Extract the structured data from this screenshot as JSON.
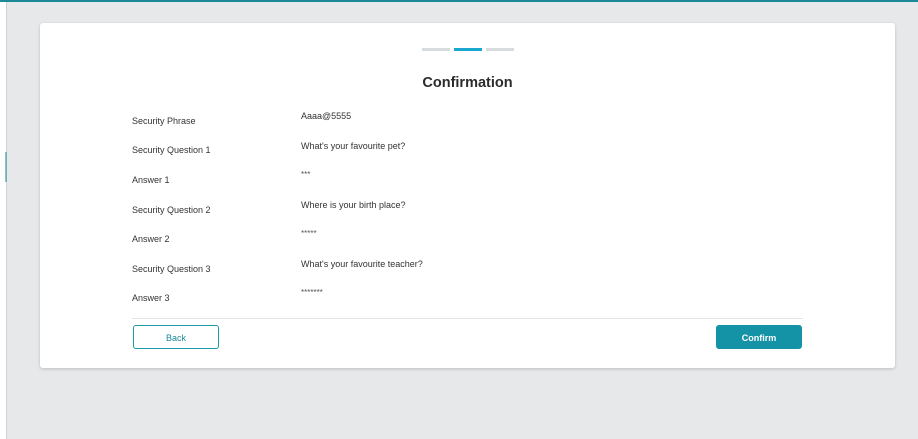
{
  "stepper": {
    "steps": [
      {
        "state": "inactive",
        "color": "#d9dcde"
      },
      {
        "state": "active",
        "color": "#1aa7cf"
      },
      {
        "state": "inactive",
        "color": "#d9dcde"
      }
    ]
  },
  "title": "Confirmation",
  "rows": [
    {
      "label": "Security Phrase",
      "value": "Aaaa@5555"
    },
    {
      "label": "Security Question 1",
      "value": "What's your favourite pet?"
    },
    {
      "label": "Answer 1",
      "value": "***"
    },
    {
      "label": "Security Question 2",
      "value": "Where is your birth place?"
    },
    {
      "label": "Answer 2",
      "value": "*****"
    },
    {
      "label": "Security Question 3",
      "value": "What's your favourite teacher?"
    },
    {
      "label": "Answer 3",
      "value": "*******"
    }
  ],
  "buttons": {
    "back_label": "Back",
    "confirm_label": "Confirm"
  },
  "colors": {
    "accent": "#1593a6",
    "background": "#e6e8e9",
    "card": "#ffffff"
  }
}
